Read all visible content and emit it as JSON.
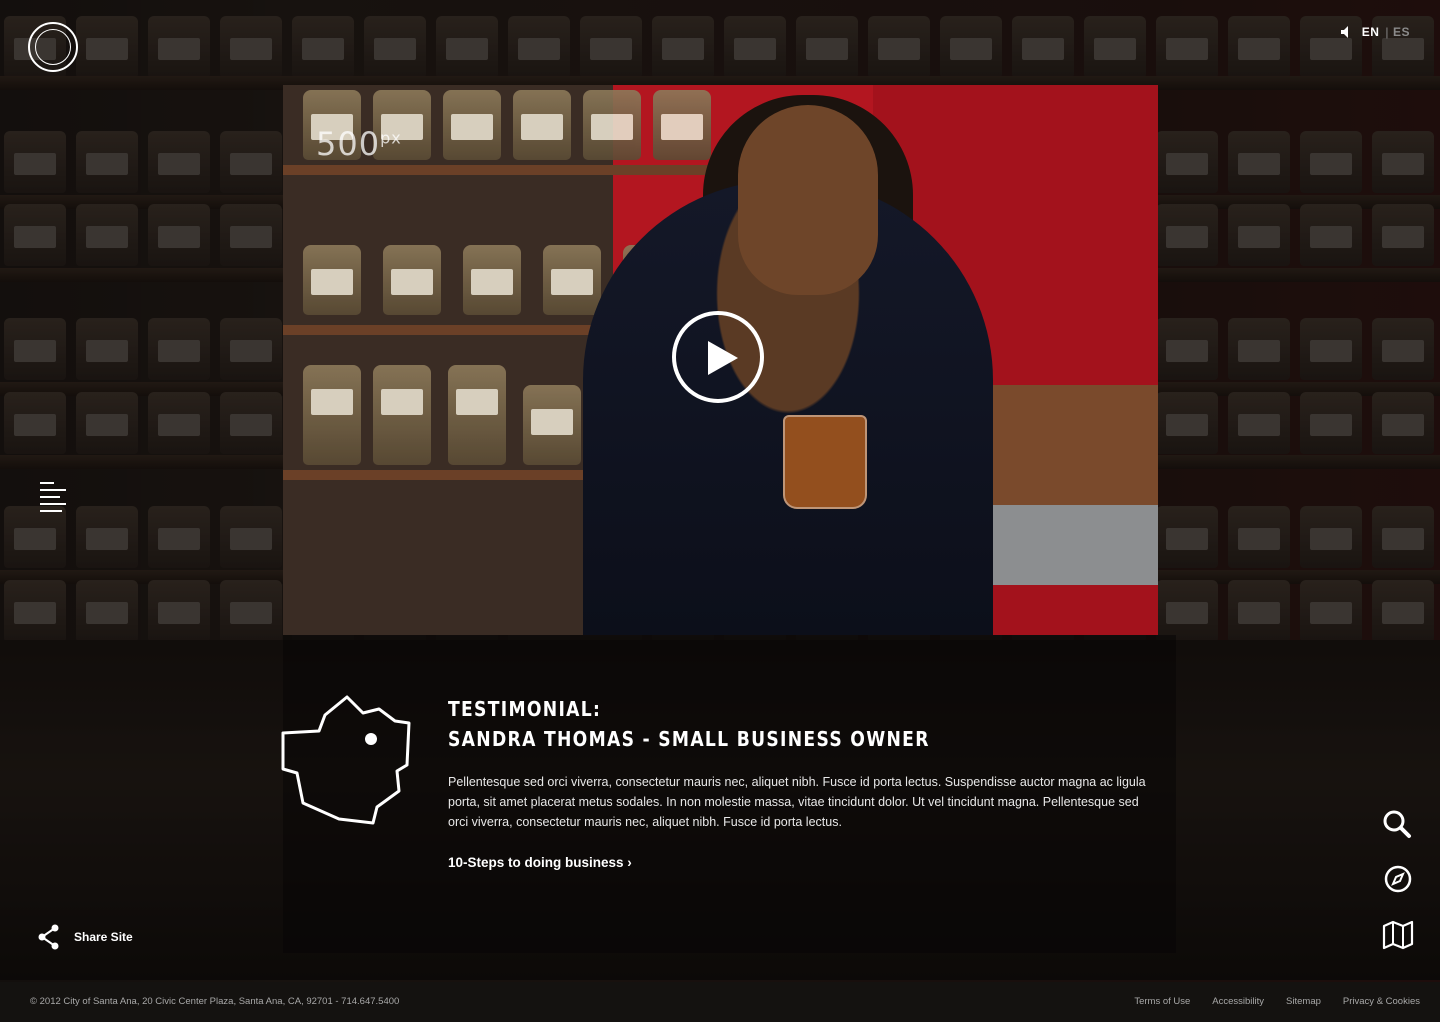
{
  "header": {
    "logo_icon": "city-seal-logo",
    "sound_icon": "speaker-icon",
    "lang_active": "EN",
    "lang_separator": "|",
    "lang_other": "ES"
  },
  "video": {
    "watermark": "500",
    "watermark_sup": "px",
    "play_icon": "play-icon"
  },
  "testimonial": {
    "title_line1": "TESTIMONIAL:",
    "title_line2": "SANDRA THOMAS - SMALL BUSINESS OWNER",
    "body": "Pellentesque sed orci viverra, consectetur mauris nec, aliquet nibh. Fusce id porta lectus. Suspendisse auctor magna ac ligula porta, sit amet placerat metus sodales. In non molestie massa, vitae tincidunt dolor. Ut vel tincidunt magna. Pellentesque sed orci viverra, consectetur mauris nec, aliquet nibh. Fusce id porta lectus.",
    "link_label": "10-Steps to doing business ›"
  },
  "share": {
    "label": "Share Site"
  },
  "tools": [
    "search-icon",
    "compass-icon",
    "map-icon"
  ],
  "footer": {
    "copyright": "© 2012 City of Santa Ana, 20 Civic Center Plaza, Santa Ana, CA, 92701 - 714.647.5400",
    "links": [
      "Terms of Use",
      "Accessibility",
      "Sitemap",
      "Privacy & Cookies"
    ]
  }
}
